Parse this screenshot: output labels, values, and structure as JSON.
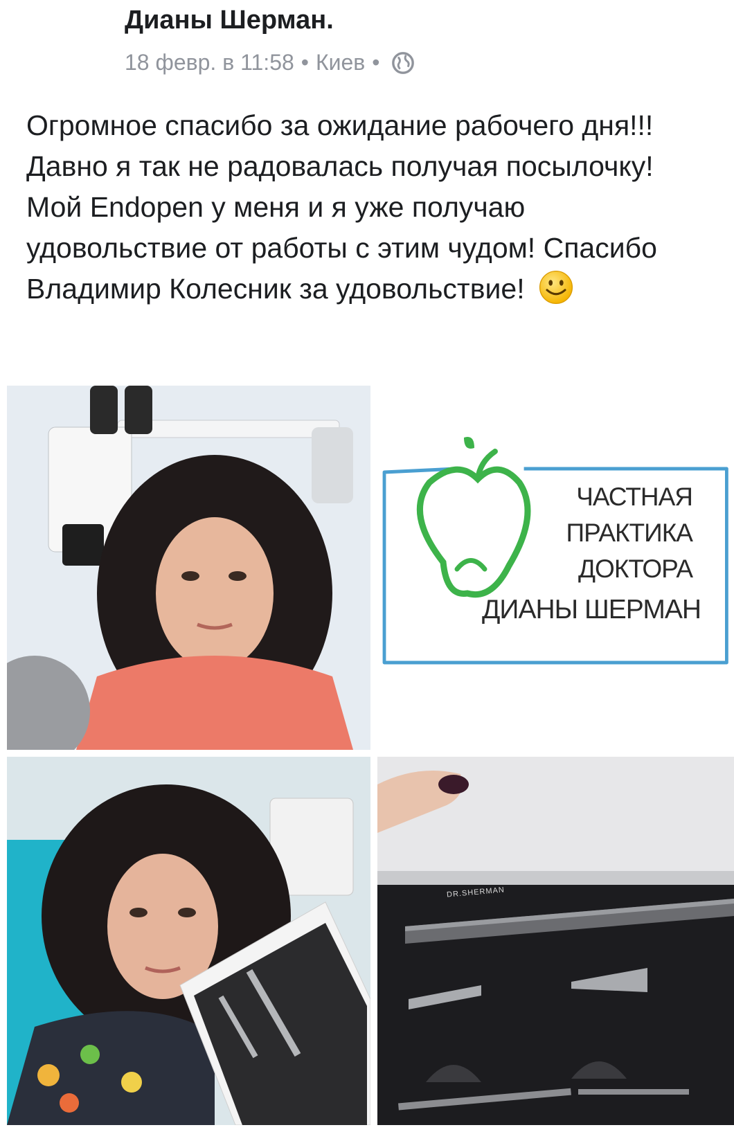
{
  "post": {
    "author": "Дианы Шерман.",
    "date": "18 февр. в 11:58",
    "separator": "•",
    "location": "Киев",
    "privacy_icon": "globe-icon",
    "text": "Огромное спасибо за ожидание рабочего дня!!! Давно я так не радовалась получая посылочку! Мой Endopen у меня и я уже получаю удовольствие от работы с этим чудом! Спасибо Владимир Колесник за удовольствие!",
    "emoji": "smiley-emoji"
  },
  "photos": {
    "logo": {
      "line1": "ЧАСТНАЯ",
      "line2": "ПРАКТИКА",
      "line3": "ДОКТОРА",
      "line4": "ДИАНЫ ШЕРМАН"
    },
    "engraving": "DR.SHERMAN"
  },
  "colors": {
    "meta_gray": "#90949c",
    "logo_green": "#3db34a",
    "logo_blue": "#4a9fd1"
  }
}
